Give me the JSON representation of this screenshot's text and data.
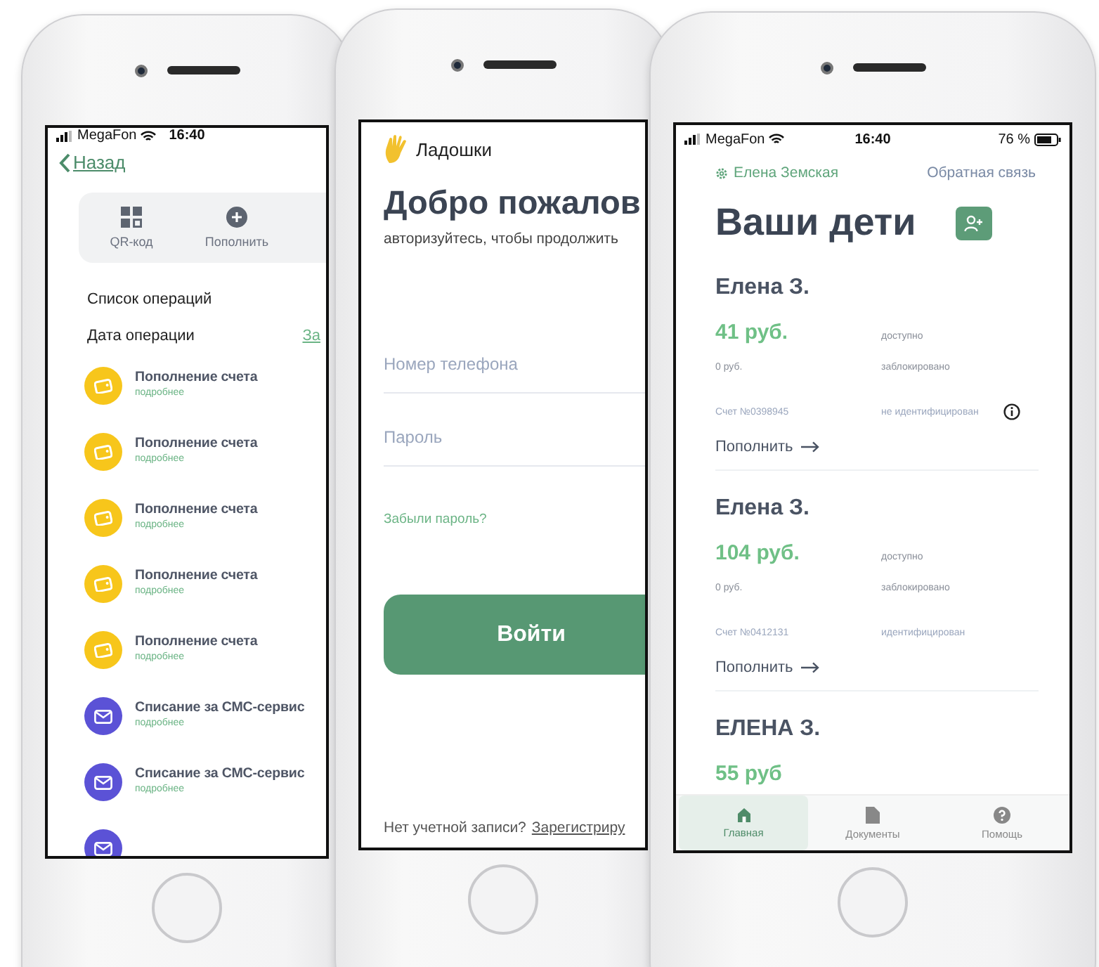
{
  "phones": [
    {
      "kind": "operations",
      "status_bar": {
        "carrier": "MegaFon",
        "time": "16:40"
      },
      "back": "Назад",
      "actions": [
        {
          "kind": "qr",
          "label": "QR-код"
        },
        {
          "kind": "plus",
          "label": "Пополнить"
        }
      ],
      "section_title": "Список операций",
      "date_label": "Дата операции",
      "date_link": "За",
      "operations": [
        {
          "kind": "topup",
          "title": "Пополнение счета",
          "link": "подробнее"
        },
        {
          "kind": "topup",
          "title": "Пополнение счета",
          "link": "подробнее"
        },
        {
          "kind": "topup",
          "title": "Пополнение счета",
          "link": "подробнее"
        },
        {
          "kind": "topup",
          "title": "Пополнение счета",
          "link": "подробнее"
        },
        {
          "kind": "topup",
          "title": "Пополнение счета",
          "link": "подробнее"
        },
        {
          "kind": "sms",
          "title": "Списание за СМС-сервис",
          "link": "подробнее"
        },
        {
          "kind": "sms",
          "title": "Списание за СМС-сервис",
          "link": "подробнее"
        },
        {
          "kind": "sms"
        }
      ]
    },
    {
      "kind": "login",
      "logo": "Ладошки",
      "title": "Добро пожалов",
      "subtitle": "авторизуйтесь, чтобы продолжить",
      "fields": [
        {
          "placeholder": "Номер телефона"
        },
        {
          "placeholder": "Пароль"
        }
      ],
      "forgot": "Забыли пароль?",
      "button": "Войти",
      "footer_text": "Нет учетной записи?",
      "footer_link": "Зарегистриру"
    },
    {
      "kind": "children",
      "status_bar": {
        "carrier": "MegaFon",
        "time": "16:40",
        "battery": "76 %"
      },
      "user": "Елена Земская",
      "feedback": "Обратная связь",
      "title": "Ваши дети",
      "cards": [
        {
          "name": "Елена З.",
          "amount": "41 руб.",
          "available": "доступно",
          "blocked_amount": "0 руб.",
          "blocked": "заблокировано",
          "account": "Счет №0398945",
          "status": "не идентифицирован",
          "info": true,
          "action": "Пополнить"
        },
        {
          "name": "Елена З.",
          "amount": "104 руб.",
          "available": "доступно",
          "blocked_amount": "0 руб.",
          "blocked": "заблокировано",
          "account": "Счет №0412131",
          "status": "идентифицирован",
          "info": false,
          "action": "Пополнить"
        },
        {
          "name": "ЕЛЕНА З.",
          "amount": "55 руб"
        }
      ],
      "tabs": [
        {
          "kind": "home",
          "label": "Главная",
          "selected": true
        },
        {
          "kind": "doc",
          "label": "Документы",
          "selected": false
        },
        {
          "kind": "help",
          "label": "Помощь",
          "selected": false
        }
      ]
    }
  ]
}
